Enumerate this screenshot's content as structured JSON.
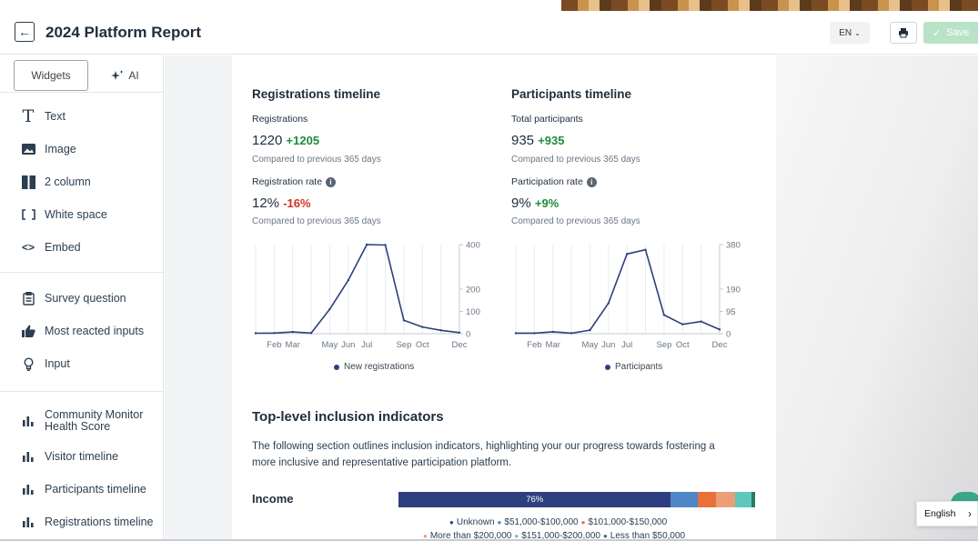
{
  "header": {
    "title": "2024 Platform Report",
    "lang": "EN",
    "save_label": "Save"
  },
  "sidebar": {
    "tabs": [
      {
        "label": "Widgets"
      },
      {
        "label": "AI"
      }
    ],
    "group1": [
      {
        "label": "Text",
        "icon": "text-icon"
      },
      {
        "label": "Image",
        "icon": "image-icon"
      },
      {
        "label": "2 column",
        "icon": "columns-icon"
      },
      {
        "label": "White space",
        "icon": "whitespace-icon"
      },
      {
        "label": "Embed",
        "icon": "embed-icon"
      }
    ],
    "group2": [
      {
        "label": "Survey question",
        "icon": "survey-icon"
      },
      {
        "label": "Most reacted inputs",
        "icon": "thumbs-up-icon"
      },
      {
        "label": "Input",
        "icon": "lightbulb-icon"
      }
    ],
    "group3": [
      {
        "label": "Community Monitor Health Score",
        "icon": "bar-chart-icon"
      },
      {
        "label": "Visitor timeline",
        "icon": "bar-chart-icon"
      },
      {
        "label": "Participants timeline",
        "icon": "bar-chart-icon"
      },
      {
        "label": "Registrations timeline",
        "icon": "bar-chart-icon"
      }
    ]
  },
  "registrations": {
    "title": "Registrations timeline",
    "metric1_label": "Registrations",
    "metric1_value": "1220",
    "metric1_delta": "+1205",
    "compare1": "Compared to previous 365 days",
    "metric2_label": "Registration rate",
    "metric2_value": "12%",
    "metric2_delta": "-16%",
    "compare2": "Compared to previous 365 days",
    "legend": "New registrations"
  },
  "participants": {
    "title": "Participants timeline",
    "metric1_label": "Total participants",
    "metric1_value": "935",
    "metric1_delta": "+935",
    "compare1": "Compared to previous 365 days",
    "metric2_label": "Participation rate",
    "metric2_value": "9%",
    "metric2_delta": "+9%",
    "compare2": "Compared to previous 365 days",
    "legend": "Participants"
  },
  "inclusion": {
    "title": "Top-level inclusion indicators",
    "description": "The following section outlines inclusion indicators, highlighting your our progress towards fostering a more inclusive and representative participation platform.",
    "income_label": "Income",
    "income_segments": [
      {
        "label": "76%",
        "value": 76,
        "color": "#2e3f7f"
      },
      {
        "label": "",
        "value": 7.5,
        "color": "#4f86c6"
      },
      {
        "label": "",
        "value": 5,
        "color": "#e8703a"
      },
      {
        "label": "",
        "value": 5.5,
        "color": "#ec9f77"
      },
      {
        "label": "",
        "value": 4.5,
        "color": "#5fc7bb"
      },
      {
        "label": "",
        "value": 1,
        "color": "#2a7a68"
      }
    ],
    "legend_row1": [
      {
        "label": "Unknown",
        "color": "#2e3f7f"
      },
      {
        "label": "$51,000-$100,000",
        "color": "#4f86c6"
      },
      {
        "label": "$101,000-$150,000",
        "color": "#e8703a"
      }
    ],
    "legend_row2": [
      {
        "label": "More than $200,000",
        "color": "#ec9f77"
      },
      {
        "label": "$151,000-$200,000",
        "color": "#5fc7bb"
      },
      {
        "label": "Less than $50,000",
        "color": "#2a7a68"
      }
    ]
  },
  "footer": {
    "language": "English"
  },
  "chart_data": [
    {
      "type": "line",
      "title": "Registrations timeline",
      "series": [
        {
          "name": "New registrations",
          "values": [
            2,
            3,
            8,
            3,
            110,
            240,
            400,
            398,
            60,
            30,
            15,
            5
          ]
        }
      ],
      "x": [
        "Jan",
        "Feb",
        "Mar",
        "Apr",
        "May",
        "Jun",
        "Jul",
        "Aug",
        "Sep",
        "Oct",
        "Nov",
        "Dec"
      ],
      "xticks": [
        "Feb",
        "Mar",
        "May",
        "Jun",
        "Jul",
        "Sep",
        "Oct",
        "Dec"
      ],
      "yticks": [
        0,
        100,
        200,
        400
      ],
      "ylim": [
        0,
        400
      ],
      "color": "#2e3f7f"
    },
    {
      "type": "line",
      "title": "Participants timeline",
      "series": [
        {
          "name": "Participants",
          "values": [
            2,
            2,
            8,
            2,
            15,
            130,
            340,
            358,
            80,
            40,
            52,
            18
          ]
        }
      ],
      "x": [
        "Jan",
        "Feb",
        "Mar",
        "Apr",
        "May",
        "Jun",
        "Jul",
        "Aug",
        "Sep",
        "Oct",
        "Nov",
        "Dec"
      ],
      "xticks": [
        "Feb",
        "Mar",
        "May",
        "Jun",
        "Jul",
        "Sep",
        "Oct",
        "Dec"
      ],
      "yticks": [
        0,
        95,
        190,
        380
      ],
      "ylim": [
        0,
        380
      ],
      "color": "#2e3f7f"
    }
  ]
}
